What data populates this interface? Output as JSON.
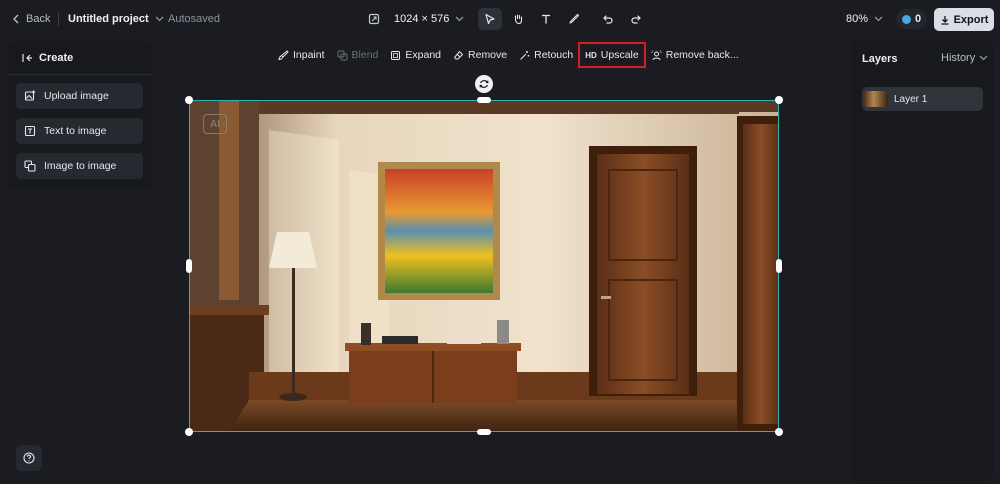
{
  "topbar": {
    "back_label": "Back",
    "project_title": "Untitled project",
    "autosave_status": "Autosaved",
    "canvas_size": "1024 × 576",
    "zoom": "80%",
    "credits": "0",
    "export_label": "Export"
  },
  "create_panel": {
    "title": "Create",
    "items": [
      {
        "label": "Upload image",
        "icon": "upload-image-icon"
      },
      {
        "label": "Text to image",
        "icon": "text-image-icon"
      },
      {
        "label": "Image to image",
        "icon": "image-to-image-icon"
      }
    ]
  },
  "edit_toolbar": {
    "items": [
      {
        "label": "Inpaint",
        "icon": "inpaint-brush-icon"
      },
      {
        "label": "Blend",
        "icon": "blend-icon",
        "disabled": true
      },
      {
        "label": "Expand",
        "icon": "expand-icon"
      },
      {
        "label": "Remove",
        "icon": "eraser-icon"
      },
      {
        "label": "Retouch",
        "icon": "magic-wand-icon"
      },
      {
        "label": "Upscale",
        "icon": "hd-icon",
        "icon_text": "HD",
        "highlighted": true
      },
      {
        "label": "Remove back...",
        "icon": "remove-background-icon"
      }
    ]
  },
  "canvas": {
    "watermark": "AI"
  },
  "layers_panel": {
    "title": "Layers",
    "history_label": "History",
    "layers": [
      {
        "name": "Layer 1"
      }
    ]
  },
  "colors": {
    "background": "#1a1c21",
    "panel": "#17191d",
    "selection": "#2bb5ad",
    "highlight_outline": "#d21f26",
    "export_button": "#d9dde4"
  }
}
